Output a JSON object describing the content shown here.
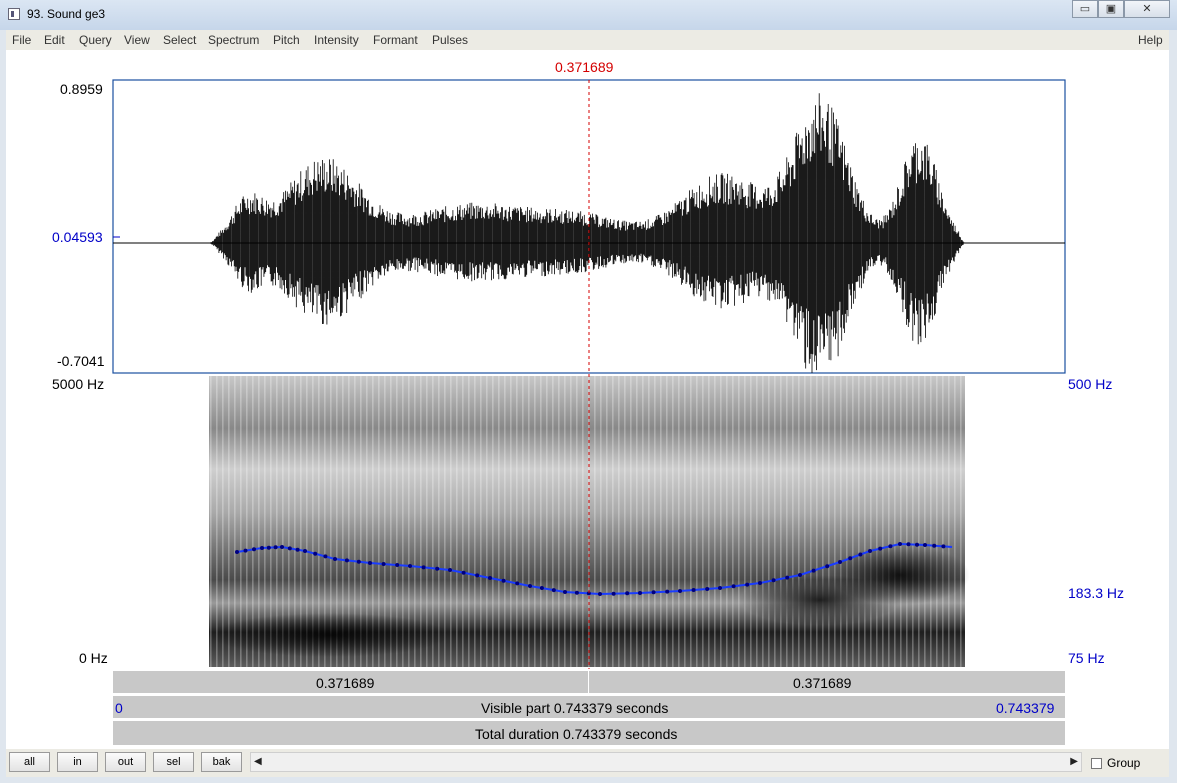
{
  "window": {
    "title": "93. Sound ge3",
    "min": "▭",
    "max": "▣",
    "close": "✕"
  },
  "menu": [
    "File",
    "Edit",
    "Query",
    "View",
    "Select",
    "Spectrum",
    "Pitch",
    "Intensity",
    "Formant",
    "Pulses"
  ],
  "help": "Help",
  "cursor": {
    "time": "0.371689"
  },
  "waveform": {
    "max": "0.8959",
    "mid": "0.04593",
    "min": "-0.7041"
  },
  "spectrogram": {
    "top": "5000 Hz",
    "bottom": "0 Hz"
  },
  "pitch": {
    "top": "500 Hz",
    "cursor_value": "183.3 Hz",
    "bottom": "75 Hz",
    "line_color": "#1a3cff"
  },
  "time_bar": {
    "left_segment": "0.371689",
    "right_segment": "0.371689"
  },
  "visible_bar": {
    "start": "0",
    "text": "Visible part 0.743379 seconds",
    "end": "0.743379"
  },
  "total_bar": {
    "text": "Total duration 0.743379 seconds"
  },
  "buttons": {
    "all": "all",
    "in": "in",
    "out": "out",
    "sel": "sel",
    "bak": "bak"
  },
  "group_label": "Group",
  "colors": {
    "cursor": "#d40000",
    "axis_blue": "#0000c8"
  }
}
